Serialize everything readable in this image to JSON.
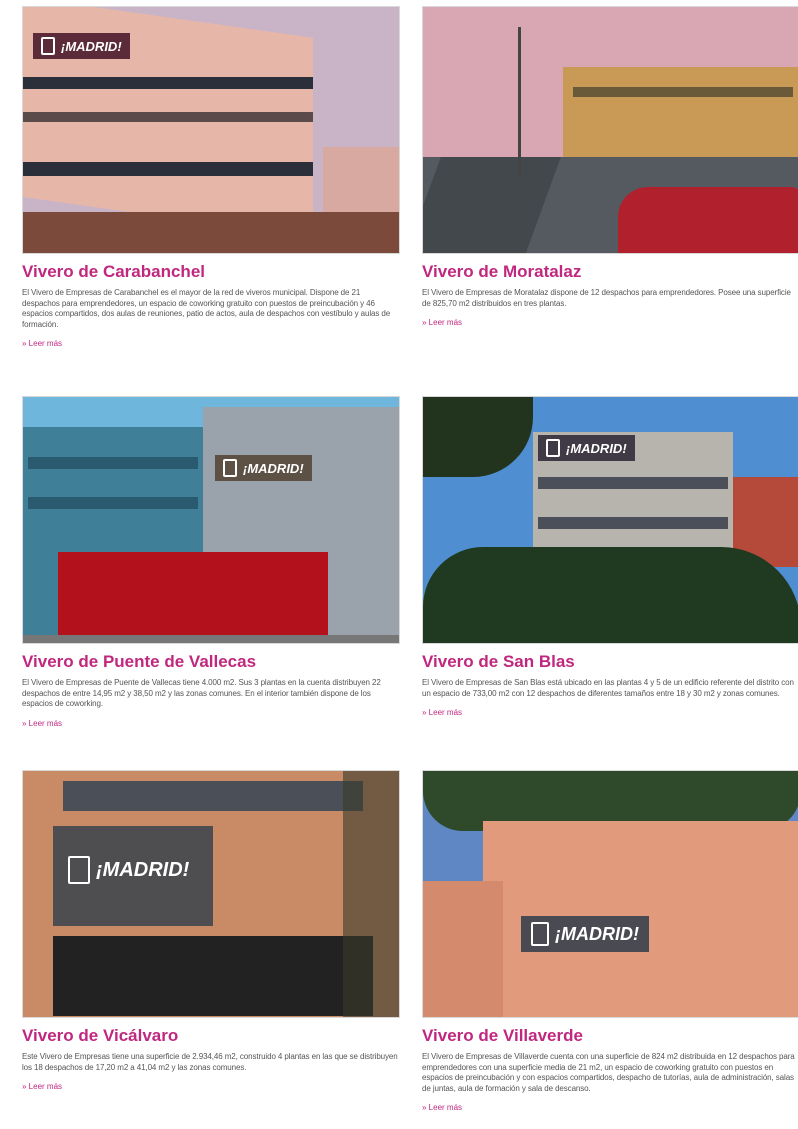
{
  "cards": [
    {
      "title": "Vivero de Carabanchel",
      "description": "El Vivero de Empresas de Carabanchel es el mayor de la red de viveros municipal. Dispone de 21 despachos para emprendedores, un espacio de coworking gratuito con puestos de preincubación y 46 espacios compartidos, dos aulas de reuniones, patio de actos, aula de despachos con vestíbulo y aulas de formación.",
      "more": "» Leer más",
      "sign": "¡MADRID!",
      "colors": {
        "sky": "#c9b3c6",
        "facade": "#e6b7a9"
      }
    },
    {
      "title": "Vivero de Moratalaz",
      "description": "El Vivero de Empresas de Moratalaz dispone de 12 despachos para emprendedores. Posee una superficie de 825,70 m2 distribuidos en tres plantas.",
      "more": "» Leer más",
      "sign": "",
      "colors": {
        "sky": "#d9a6b4",
        "facade": "#c99a55"
      }
    },
    {
      "title": "Vivero de Puente de Vallecas",
      "description": "El Vivero de Empresas de Puente de Vallecas tiene 4.000 m2. Sus 3 plantas en la cuenta distribuyen 22 despachos de entre 14,95 m2 y 38,50 m2 y las zonas comunes. En el interior también dispone de los espacios de coworking.",
      "more": "» Leer más",
      "sign": "¡MADRID!",
      "colors": {
        "sky": "#6fb6dc",
        "facade": "#9aa3ab"
      }
    },
    {
      "title": "Vivero de San Blas",
      "description": "El Vivero de Empresas de San Blas está ubicado en las plantas 4 y 5 de un edificio referente del distrito con un espacio de 733,00 m2 con 12 despachos de diferentes tamaños entre 18 y 30 m2 y zonas comunes.",
      "more": "» Leer más",
      "sign": "¡MADRID!",
      "colors": {
        "sky": "#4f8fd1",
        "facade": "#b7b4ae"
      }
    },
    {
      "title": "Vivero de Vicálvaro",
      "description": "Este Vivero de Empresas tiene una superficie de 2.934,46 m2, construido 4 plantas en las que se distribuyen los 18 despachos de 17,20 m2 a 41,04 m2 y las zonas comunes.",
      "more": "» Leer más",
      "sign": "¡MADRID!",
      "colors": {
        "sky": "#b07a5f",
        "facade": "#c98a66"
      }
    },
    {
      "title": "Vivero de Villaverde",
      "description": "El Vivero de Empresas de Villaverde cuenta con una superficie de 824 m2 distribuida en 12 despachos para emprendedores con una superficie media de 21 m2, un espacio de coworking gratuito con puestos en espacios de preincubación y con espacios compartidos, despacho de tutorías, aula de administración, salas de juntas, aula de formación y sala de descanso.",
      "more": "» Leer más",
      "sign": "¡MADRID!",
      "colors": {
        "sky": "#5e87c4",
        "facade": "#e19a7c"
      }
    }
  ]
}
